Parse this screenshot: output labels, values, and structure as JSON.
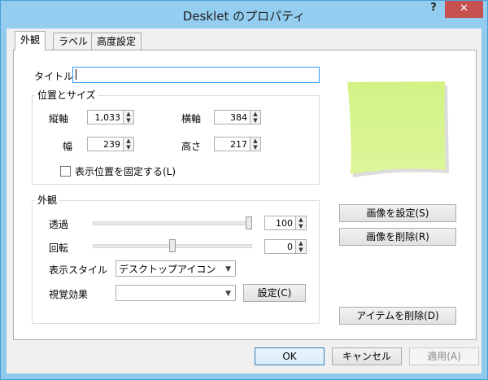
{
  "window": {
    "title": "Desklet のプロパティ",
    "help": "?",
    "close": "✕"
  },
  "tabs": [
    "外観",
    "ラベル",
    "高度設定"
  ],
  "title_field": {
    "label": "タイトル",
    "value": ""
  },
  "position": {
    "group_label": "位置とサイズ",
    "vertical": {
      "label": "縦軸",
      "value": "1,033"
    },
    "horizontal": {
      "label": "横軸",
      "value": "384"
    },
    "width": {
      "label": "幅",
      "value": "239"
    },
    "height": {
      "label": "高さ",
      "value": "217"
    },
    "lock": {
      "label": "表示位置を固定する(L)",
      "checked": false
    }
  },
  "appearance": {
    "group_label": "外観",
    "transparency": {
      "label": "透過",
      "value": "100",
      "fraction": 1.0
    },
    "rotation": {
      "label": "回転",
      "value": "0",
      "fraction": 0.5
    },
    "display_style": {
      "label": "表示スタイル",
      "value": "デスクトップアイコン"
    },
    "visual_effect": {
      "label": "視覚効果",
      "value": "",
      "button": "設定(C)"
    }
  },
  "preview_color": "#d6f48c",
  "side_buttons": {
    "set_image": "画像を設定(S)",
    "delete_image": "画像を削除(R)",
    "delete_item": "アイテムを削除(D)"
  },
  "footer": {
    "ok": "OK",
    "cancel": "キャンセル",
    "apply": "適用(A)"
  }
}
